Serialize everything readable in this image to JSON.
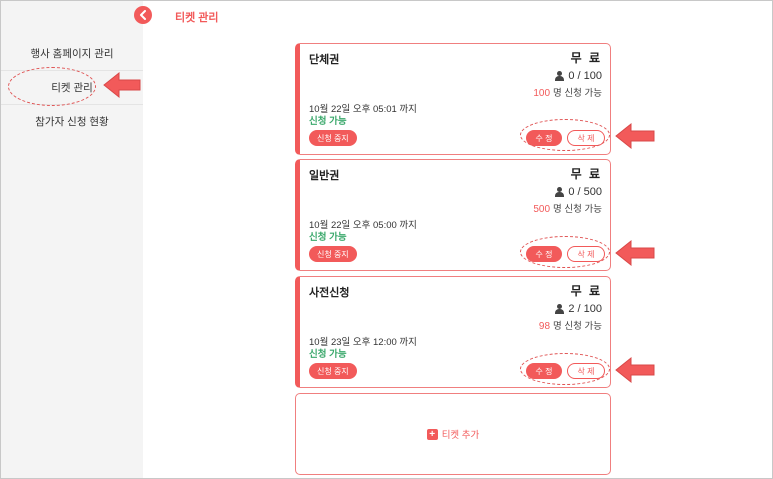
{
  "page": {
    "title": "티켓 관리",
    "collapse_icon": "chevron-left-icon"
  },
  "sidebar": {
    "items": [
      {
        "label": "행사 홈페이지 관리"
      },
      {
        "label": "티켓 관리"
      },
      {
        "label": "참가자 신청 현황"
      }
    ]
  },
  "tickets": [
    {
      "name": "단체권",
      "price": "무 료",
      "count": "0 / 100",
      "avail_num": "100",
      "avail_text": "명 신청 가능",
      "deadline": "10월 22일 오후 05:01 까지",
      "status": "신청 가능",
      "stop_label": "신청 중지",
      "edit_label": "수 정",
      "delete_label": "삭 제"
    },
    {
      "name": "일반권",
      "price": "무 료",
      "count": "0 / 500",
      "avail_num": "500",
      "avail_text": "명 신청 가능",
      "deadline": "10월 22일 오후 05:00 까지",
      "status": "신청 가능",
      "stop_label": "신청 중지",
      "edit_label": "수 정",
      "delete_label": "삭 제"
    },
    {
      "name": "사전신청",
      "price": "무 료",
      "count": "2 / 100",
      "avail_num": "98",
      "avail_text": "명 신청 가능",
      "deadline": "10월 23일 오후 12:00 까지",
      "status": "신청 가능",
      "stop_label": "신청 중지",
      "edit_label": "수 정",
      "delete_label": "삭 제"
    }
  ],
  "add_ticket": {
    "label": "티켓 추가"
  },
  "colors": {
    "accent": "#f25a5a",
    "status_green": "#3aa86b",
    "sidebar_bg": "#f4f4f4"
  }
}
